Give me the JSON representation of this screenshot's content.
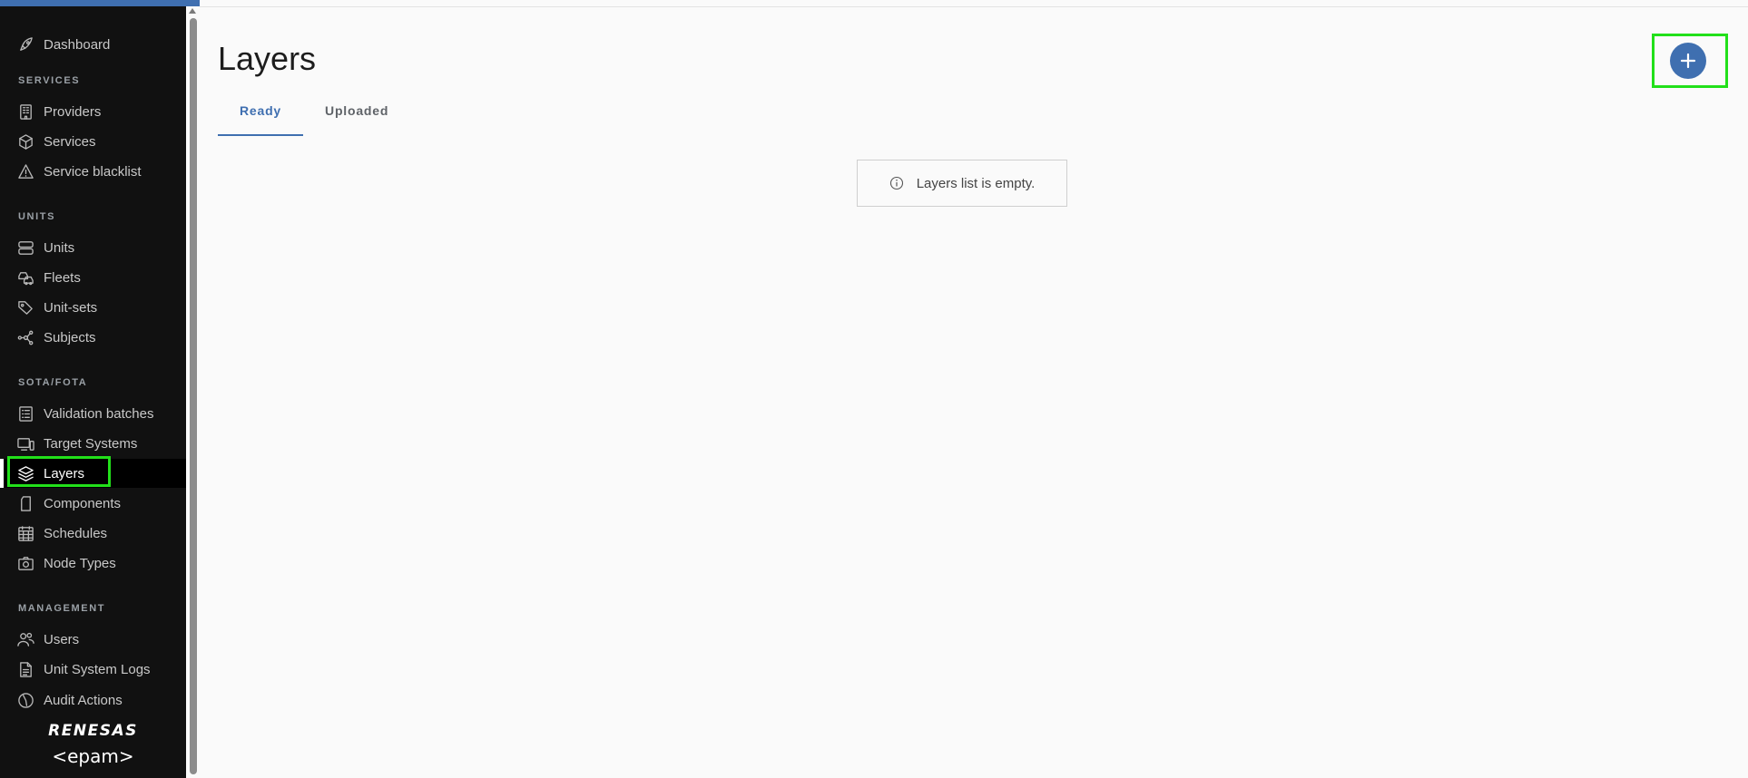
{
  "sidebar": {
    "dashboard": "Dashboard",
    "sections": {
      "services": "SERVICES",
      "units": "UNITS",
      "sota": "SOTA/FOTA",
      "management": "MANAGEMENT"
    },
    "items": {
      "providers": "Providers",
      "services": "Services",
      "service_blacklist": "Service blacklist",
      "units": "Units",
      "fleets": "Fleets",
      "unit_sets": "Unit-sets",
      "subjects": "Subjects",
      "validation_batches": "Validation batches",
      "target_systems": "Target Systems",
      "layers": "Layers",
      "components": "Components",
      "schedules": "Schedules",
      "node_types": "Node Types",
      "users": "Users",
      "unit_system_logs": "Unit System Logs",
      "audit_actions": "Audit Actions"
    },
    "active_item": "Layers",
    "logos": {
      "renesas": "RENESAS",
      "epam": "<epam>"
    }
  },
  "main": {
    "title": "Layers",
    "tabs": [
      {
        "label": "Ready",
        "active": true
      },
      {
        "label": "Uploaded",
        "active": false
      }
    ],
    "empty_message": "Layers list is empty.",
    "add_button_icon": "plus-icon"
  },
  "colors": {
    "accent": "#3f6fb0",
    "sidebar_bg": "#111111",
    "highlight": "#22e01a"
  }
}
